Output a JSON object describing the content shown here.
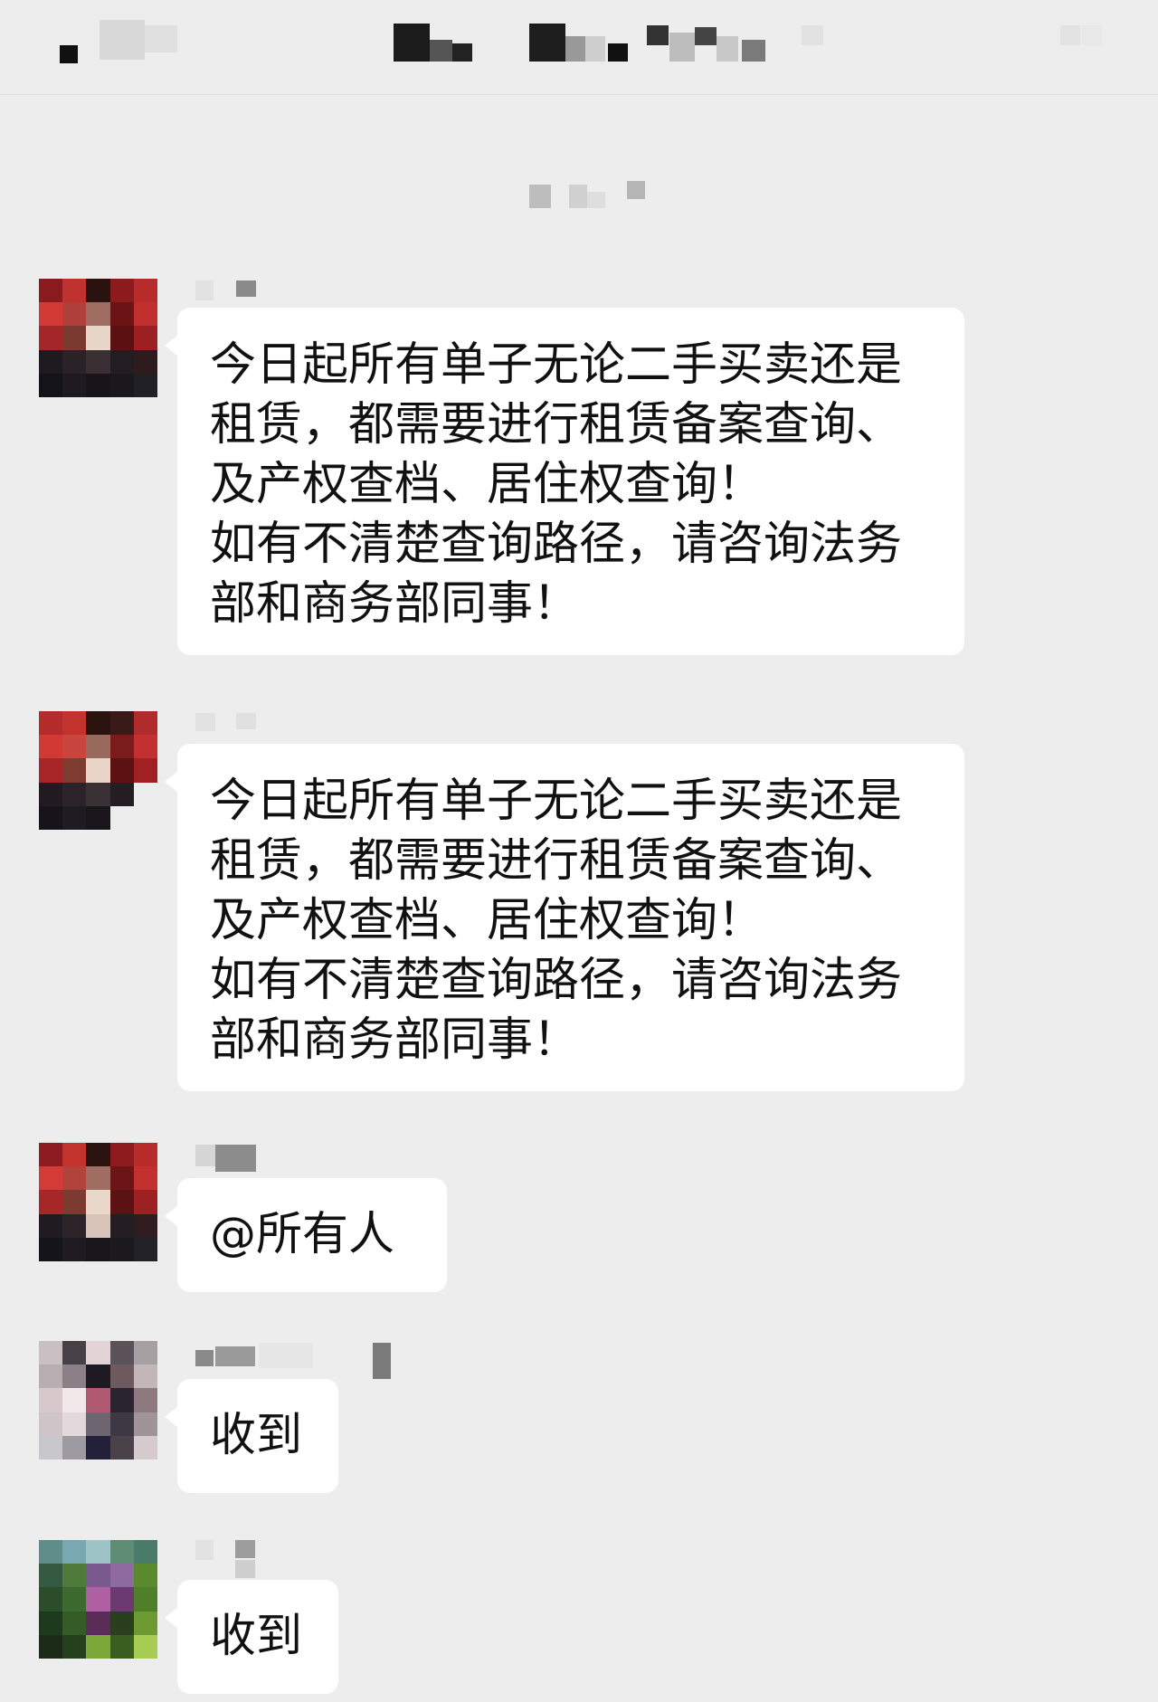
{
  "messages": [
    {
      "lines": [
        "今日起所有单子无论二手买卖还是",
        "租赁，都需要进行租赁备案查询、",
        "及产权查档、居住权查询！",
        "如有不清楚查询路径，请咨询法务",
        "部和商务部同事！"
      ]
    },
    {
      "lines": [
        "今日起所有单子无论二手买卖还是",
        "租赁，都需要进行租赁备案查询、",
        "及产权查档、居住权查询！",
        "如有不清楚查询路径，请咨询法务",
        "部和商务部同事！"
      ]
    },
    {
      "lines": [
        "@所有人"
      ]
    },
    {
      "lines": [
        "收到"
      ]
    },
    {
      "lines": [
        "收到"
      ]
    }
  ]
}
